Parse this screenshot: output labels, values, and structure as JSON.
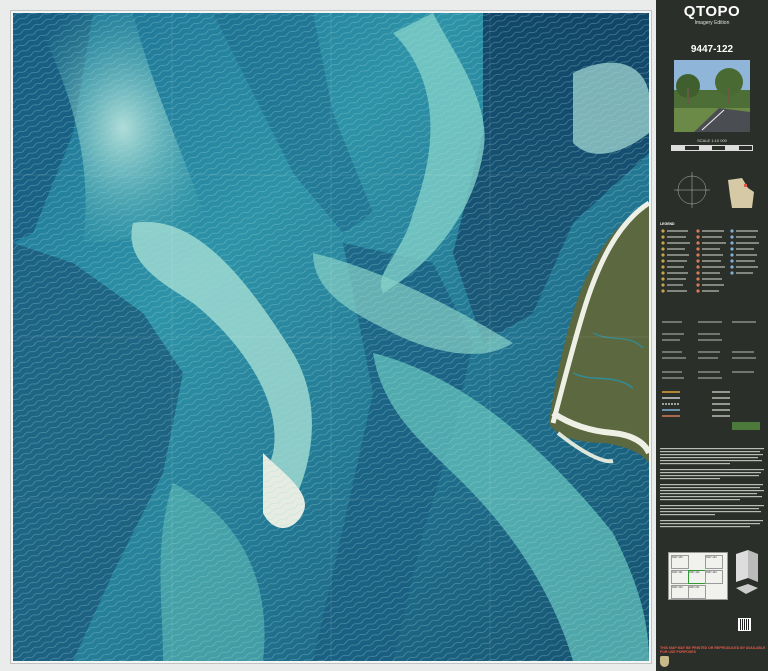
{
  "panel": {
    "brand": "QTOPO",
    "edition": "Imagery Edition",
    "sheet_number": "9447-122",
    "scale": "SCALE 1:10 000",
    "footer_warning": "THIS MAP MAY BE PRINTED OR REPRODUCED BY AVAILABLE FOR USE PURPOSES"
  },
  "index_map": {
    "cells": [
      "9447-143",
      "9447-144",
      "9447-121",
      "9447-122",
      "9447-123",
      "9447-124",
      "9447-211"
    ]
  },
  "map": {
    "type": "satellite-imagery",
    "colors": {
      "deep_water": "#0f3f66",
      "shallow": "#3fb2b4",
      "sand": "#d9e2d6",
      "land": "#5f6a42"
    }
  }
}
